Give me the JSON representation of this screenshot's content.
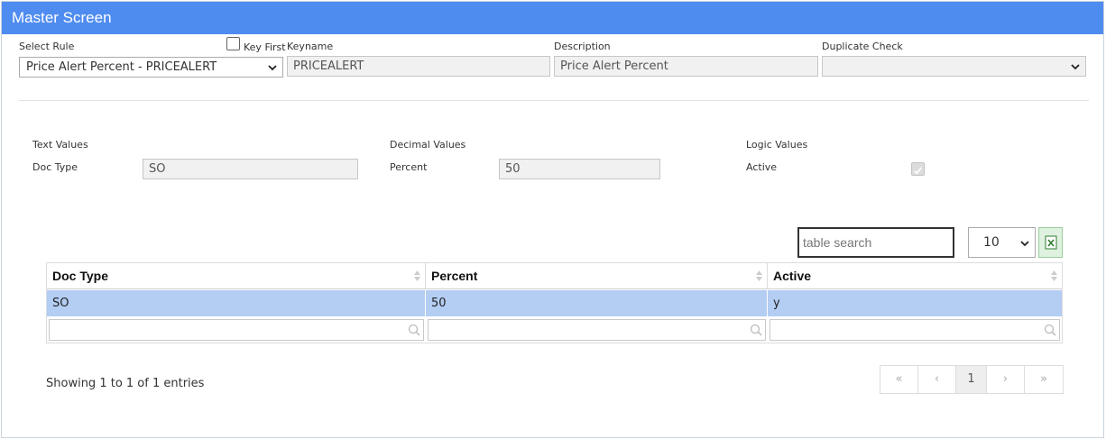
{
  "window": {
    "title": "Master Screen"
  },
  "header": {
    "select_rule_label": "Select Rule",
    "select_rule_value": "Price Alert Percent - PRICEALERT",
    "key_first_label": "Key First",
    "key_first_checked": false,
    "keyname_label": "Keyname",
    "keyname_value": "PRICEALERT",
    "description_label": "Description",
    "description_value": "Price Alert Percent",
    "duplicate_check_label": "Duplicate Check",
    "duplicate_check_value": ""
  },
  "values": {
    "text_values_label": "Text Values",
    "doc_type_label": "Doc Type",
    "doc_type_value": "SO",
    "decimal_values_label": "Decimal Values",
    "percent_label": "Percent",
    "percent_value": "50",
    "logic_values_label": "Logic Values",
    "active_label": "Active",
    "active_checked": true
  },
  "table": {
    "search_placeholder": "table search",
    "page_size": "10",
    "columns": [
      "Doc Type",
      "Percent",
      "Active"
    ],
    "rows": [
      [
        "SO",
        "50",
        "y"
      ]
    ],
    "info": "Showing 1 to 1 of 1 entries"
  },
  "pagination": {
    "first": "«",
    "prev": "‹",
    "current": "1",
    "next": "›",
    "last": "»"
  },
  "colors": {
    "titlebar": "#4f8cf0",
    "selected_row": "#b3cdf3",
    "excel_bg": "#dff1df"
  },
  "icons": [
    "chevron-down-icon",
    "sort-icon",
    "magnifier-icon",
    "excel-icon",
    "checkmark-icon"
  ]
}
